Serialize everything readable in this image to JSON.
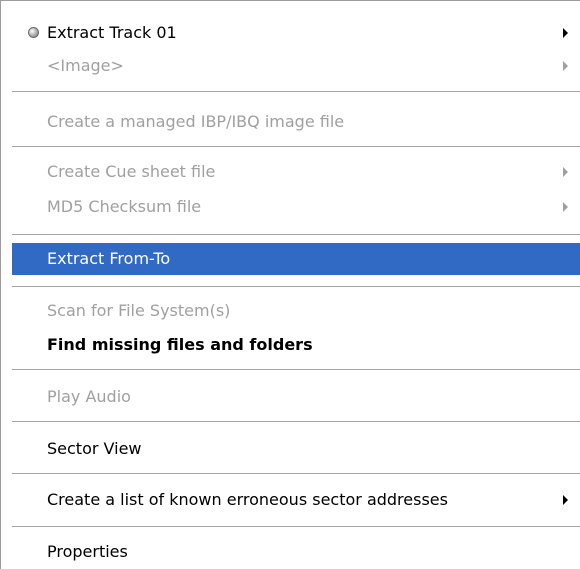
{
  "menu": {
    "items": [
      {
        "label": "Extract Track 01"
      },
      {
        "label": "<Image>"
      },
      {
        "label": "Create a managed IBP/IBQ image file"
      },
      {
        "label": "Create Cue sheet file"
      },
      {
        "label": "MD5 Checksum file"
      },
      {
        "label": "Extract From-To"
      },
      {
        "label": "Scan for File System(s)"
      },
      {
        "label": "Find missing files and folders"
      },
      {
        "label": "Play Audio"
      },
      {
        "label": "Sector View"
      },
      {
        "label": "Create a list of known erroneous sector addresses"
      },
      {
        "label": "Properties"
      }
    ]
  },
  "colors": {
    "selection": "#316ac5",
    "disabled_text": "#a0a0a0",
    "separator": "#a6a6a6"
  },
  "icons": {
    "extract_track": "radio-bullet-icon"
  }
}
